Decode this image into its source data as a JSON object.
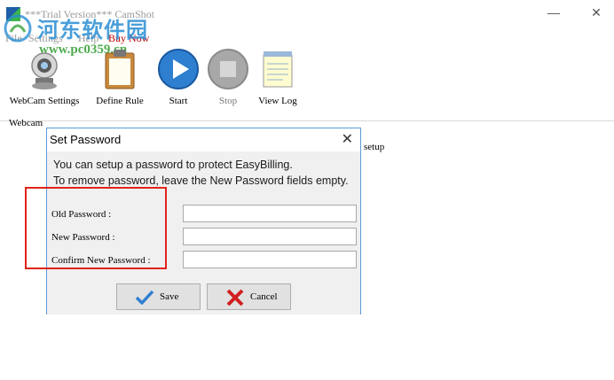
{
  "window": {
    "title": "***Trial Version*** CamShot",
    "minimize_glyph": "—",
    "close_glyph": "✕"
  },
  "watermark": {
    "title": "河东软件园",
    "url": "www.pc0359.cn"
  },
  "menu": {
    "items": [
      "File",
      "Settings",
      "Help"
    ],
    "buy_now": "Buy Now"
  },
  "toolbar": {
    "webcam_settings": "WebCam Settings",
    "define_rule": "Define Rule",
    "start": "Start",
    "stop": "Stop",
    "view_log": "View Log"
  },
  "main": {
    "webcam_label": "Webcam",
    "setup_text": "setup"
  },
  "dialog": {
    "title": "Set Password",
    "close_glyph": "✕",
    "info_line_1": "You can setup a password to protect EasyBilling.",
    "info_line_2": "To remove password, leave the New Password fields empty.",
    "old_password_label": "Old Password :",
    "new_password_label": "New Password :",
    "confirm_password_label": "Confirm New Password :",
    "old_password_value": "",
    "new_password_value": "",
    "confirm_password_value": "",
    "save_label": "Save",
    "cancel_label": "Cancel"
  },
  "colors": {
    "accent_blue": "#2f7fd0",
    "highlight_red": "#e0241c",
    "buy_now_red": "#c00000"
  }
}
